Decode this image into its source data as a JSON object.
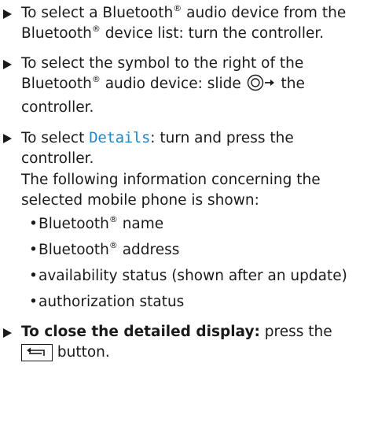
{
  "steps": [
    {
      "line_a": "To select a Bluetooth",
      "reg": "®",
      "line_b": " audio device from the Bluetooth",
      "line_c": " device list: turn the controller."
    },
    {
      "line_a": "To select the symbol to the right of the Bluetooth",
      "reg": "®",
      "line_b": " audio device: slide ",
      "line_c": " the controller."
    },
    {
      "line_a": "To select ",
      "display_text": "Details",
      "line_b": ": turn and press the controller.",
      "info_intro": "The following information concerning the selected mobile phone is shown:",
      "bullets": [
        {
          "pre": "Bluetooth",
          "reg": "®",
          "post": " name"
        },
        {
          "pre": "Bluetooth",
          "reg": "®",
          "post": " address"
        },
        {
          "pre": "availability status (shown after an update)",
          "reg": "",
          "post": ""
        },
        {
          "pre": "authorization status",
          "reg": "",
          "post": ""
        }
      ]
    },
    {
      "bold_text": "To close the detailed display:",
      "line_a": " press the ",
      "line_b": " button."
    }
  ],
  "icons": {
    "step_marker": "triangle-right-icon",
    "slide_controller": "controller-slide-right-icon",
    "back_button": "back-arrow-icon"
  },
  "colors": {
    "text": "#1a1a1a",
    "display_text": "#1e88c8"
  }
}
